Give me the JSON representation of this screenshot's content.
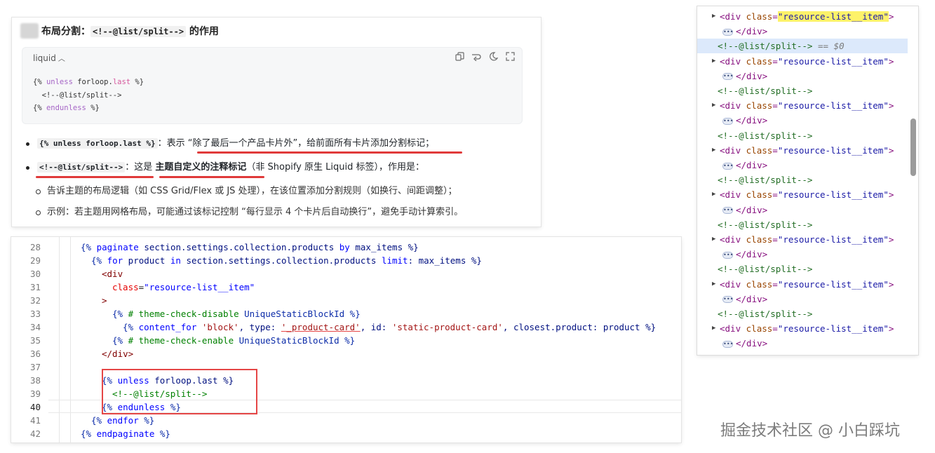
{
  "answer": {
    "heading_pre": "布局分割：",
    "heading_code": "<!--@list/split-->",
    "heading_post": " 的作用",
    "code_lang": "liquid",
    "code_line1_a": "{% ",
    "code_line1_kw": "unless",
    "code_line1_b": " forloop.",
    "code_line1_c": "last",
    "code_line1_d": " %}",
    "code_line2": "  <!--@list/split-->",
    "code_line3_a": "{% ",
    "code_line3_kw": "endunless",
    "code_line3_b": " %}",
    "bullet1_code": "{% unless forloop.last %}",
    "bullet1_text": "：表示 “除了最后一个产品卡片外”，给前面所有卡片添加分割标记；",
    "bullet2_code": "<!--@list/split-->",
    "bullet2_a": "：这是 ",
    "bullet2_bold": "主题自定义的注释标记",
    "bullet2_b": "（非 Shopify 原生 Liquid 标签），作用是：",
    "sub1": "告诉主题的布局逻辑（如 CSS Grid/Flex 或 JS 处理），在该位置添加分割规则（如换行、间距调整）；",
    "sub2": "示例：若主题用网格布局，可能通过该标记控制 “每行显示 4 个卡片后自动换行”，避免手动计算索引。"
  },
  "editor": {
    "lines": [
      {
        "n": "28"
      },
      {
        "n": "29"
      },
      {
        "n": "30"
      },
      {
        "n": "31"
      },
      {
        "n": "32"
      },
      {
        "n": "33"
      },
      {
        "n": "34"
      },
      {
        "n": "35"
      },
      {
        "n": "36"
      },
      {
        "n": "37"
      },
      {
        "n": "38"
      },
      {
        "n": "39"
      },
      {
        "n": "40"
      },
      {
        "n": "41"
      },
      {
        "n": "42"
      }
    ],
    "l28": [
      "{% ",
      "paginate",
      " section.settings.collection.products ",
      "by",
      " max_items %}"
    ],
    "l29": [
      "{% ",
      "for",
      " product ",
      "in",
      " section.settings.collection.products ",
      "limit",
      ": max_items %}"
    ],
    "l30": "<div",
    "l31": [
      "class",
      "=",
      "\"resource-list__item\""
    ],
    "l32": ">",
    "l33": [
      "{% ",
      "# theme-check-disable ",
      "UniqueStaticBlockId",
      " %}"
    ],
    "l34": [
      "{% ",
      "content_for",
      " ",
      "'block'",
      ", type: ",
      "'_product-card'",
      ", id: ",
      "'static-product-card'",
      ", closest.product: product %}"
    ],
    "l35": [
      "{% ",
      "# theme-check-enable ",
      "UniqueStaticBlockId",
      " %}"
    ],
    "l36": "</div>",
    "l38": [
      "{% ",
      "unless",
      " forloop.last %}"
    ],
    "l39": "<!--@list/split-->",
    "l40": [
      "{% ",
      "endunless",
      " %}"
    ],
    "l41": [
      "{% ",
      "endfor",
      " %}"
    ],
    "l42": [
      "{% ",
      "endpaginate",
      " %}"
    ]
  },
  "devtools": {
    "open_tag": "<div",
    "attr": "class",
    "eq": "=",
    "value": "\"resource-list__item\"",
    "close": ">",
    "end_tag": "</div>",
    "comment": "<!--@list/split-->",
    "selected_suffix": "== $0",
    "ellipsis": "•••"
  },
  "watermark": "掘金技术社区 @ 小白踩坑",
  "colors": {
    "accent_red": "#e03a3a",
    "highlight": "#fdf26a",
    "selection": "#dce9fb"
  }
}
